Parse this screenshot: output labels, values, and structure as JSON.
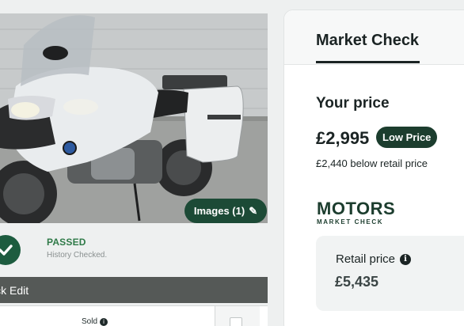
{
  "listing": {
    "images_button": "Images (1)",
    "images_icon": "pencil-icon"
  },
  "history": {
    "status": "PASSED",
    "subtext": "History Checked.",
    "icon": "check-circle-icon",
    "color": "#2f7a48"
  },
  "quick_edit": {
    "title": "ick Edit",
    "sold_label": "Sold"
  },
  "market_check": {
    "tab_title": "Market Check",
    "your_price_heading": "Your price",
    "price": "£2,995",
    "badge": "Low Price",
    "below_retail": "£2,440 below retail price",
    "logo": {
      "word": "MOTORS",
      "sub": "MARKET CHECK"
    },
    "retail_label": "Retail price",
    "retail_value": "£5,435"
  },
  "colors": {
    "brand_dark_green": "#1c3d2e",
    "passed_green": "#2f7a48",
    "quick_edit_bar": "#555957"
  }
}
